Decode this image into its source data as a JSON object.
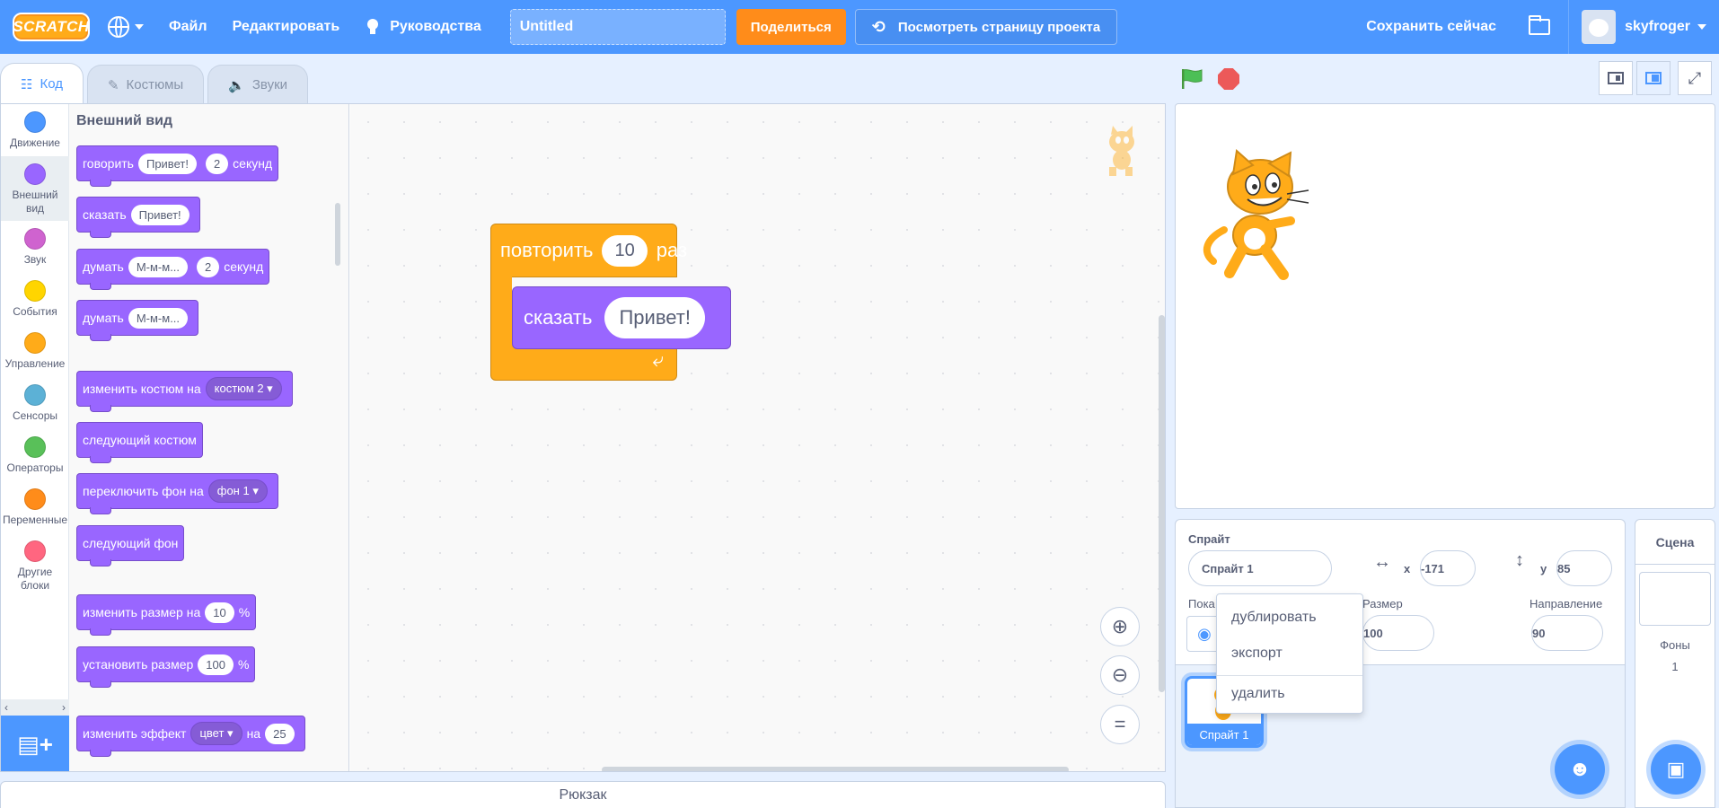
{
  "colors": {
    "accent": "#4c97ff",
    "share": "#ff8c1a",
    "control": "#ffab19",
    "looks": "#9966ff"
  },
  "menubar": {
    "logo": "SCRATCH",
    "file": "Файл",
    "edit": "Редактировать",
    "tutorials": "Руководства",
    "project_title": "Untitled",
    "share": "Поделиться",
    "see_project_page": "Посмотреть страницу проекта",
    "save_now": "Сохранить сейчас",
    "username": "skyfroger"
  },
  "tabs": {
    "code": "Код",
    "costumes": "Костюмы",
    "sounds": "Звуки"
  },
  "categories": [
    {
      "label": "Движение",
      "color": "#4c97ff"
    },
    {
      "label": "Внешний вид",
      "color": "#9966ff"
    },
    {
      "label": "Звук",
      "color": "#cf63cf"
    },
    {
      "label": "События",
      "color": "#ffd500"
    },
    {
      "label": "Управление",
      "color": "#ffab19"
    },
    {
      "label": "Сенсоры",
      "color": "#5cb1d6"
    },
    {
      "label": "Операторы",
      "color": "#59c059"
    },
    {
      "label": "Переменные",
      "color": "#ff8c1a"
    },
    {
      "label": "Другие блоки",
      "color": "#ff6680"
    }
  ],
  "palette": {
    "title": "Внешний вид",
    "say_for": {
      "verb": "говорить",
      "text": "Привет!",
      "secs": "2",
      "unit": "секунд"
    },
    "say": {
      "verb": "сказать",
      "text": "Привет!"
    },
    "think_for": {
      "verb": "думать",
      "text": "М-м-м...",
      "secs": "2",
      "unit": "секунд"
    },
    "think": {
      "verb": "думать",
      "text": "М-м-м..."
    },
    "switch_costume": {
      "verb": "изменить костюм на",
      "value": "костюм 2"
    },
    "next_costume": "следующий костюм",
    "switch_backdrop": {
      "verb": "переключить фон на",
      "value": "фон 1"
    },
    "next_backdrop": "следующий фон",
    "change_size": {
      "verb": "изменить размер на",
      "value": "10",
      "unit": "%"
    },
    "set_size": {
      "verb": "установить размер",
      "value": "100",
      "unit": "%"
    },
    "change_effect": {
      "verb": "изменить эффект",
      "effect": "цвет",
      "by": "на",
      "value": "25"
    }
  },
  "script": {
    "repeat": {
      "verb": "повторить",
      "times": "10",
      "unit": "раз"
    },
    "say": {
      "verb": "сказать",
      "text": "Привет!"
    }
  },
  "backpack": "Рюкзак",
  "sprite_info": {
    "sprite_label": "Спрайт",
    "sprite_name": "Спрайт 1",
    "x_label": "x",
    "x_value": "-171",
    "y_label": "y",
    "y_value": "85",
    "show_label": "Пока",
    "size_label": "Размер",
    "size_value": "100",
    "direction_label": "Направление",
    "direction_value": "90"
  },
  "sprite_list": [
    {
      "name": "Спрайт 1"
    }
  ],
  "context_menu": {
    "duplicate": "дублировать",
    "export": "экспорт",
    "delete": "удалить"
  },
  "stage_target": {
    "title": "Сцена",
    "backdrops_label": "Фоны",
    "backdrops_count": "1"
  }
}
